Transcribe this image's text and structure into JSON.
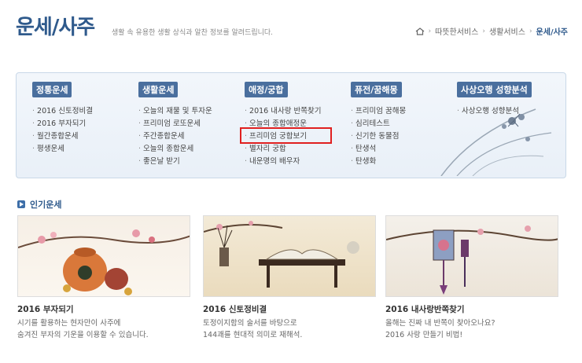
{
  "header": {
    "title": "운세/사주",
    "description": "생활 속 유용한 생활 상식과 알찬 정보를 알려드립니다.",
    "breadcrumb": [
      "따뜻한서비스",
      "생활서비스",
      "운세/사주"
    ]
  },
  "menu": {
    "columns": [
      {
        "head": "정통운세",
        "items": [
          "2016 신토정비결",
          "2016 부자되기",
          "월간종합운세",
          "평생운세"
        ]
      },
      {
        "head": "생활운세",
        "items": [
          "오늘의 재물 및 투자운",
          "프리미엄 로또운세",
          "주간종합운세",
          "오늘의 종합운세",
          "좋은날 받기"
        ]
      },
      {
        "head": "애정/궁합",
        "items": [
          "2016 내사랑 반쪽찾기",
          "오늘의 종합애정운",
          "프리미엄 궁합보기",
          "별자리 궁합",
          "내운명의 배우자"
        ]
      },
      {
        "head": "퓨전/꿈해몽",
        "items": [
          "프리미엄 꿈해몽",
          "심리테스트",
          "신기한 동물점",
          "탄생석",
          "탄생화"
        ]
      },
      {
        "head": "사상오행 성향분석",
        "items": [
          "사상오행 성향분석"
        ]
      }
    ]
  },
  "popular": {
    "title": "인기운세",
    "cards": [
      {
        "title": "2016 부자되기",
        "lines": [
          "시기를 활용하는 현자만이 사주에",
          "숨겨진 부자의 기운을 이용할 수 있습니다."
        ]
      },
      {
        "title": "2016 신토정비결",
        "lines": [
          "토정이지함의 술서를 바탕으로",
          "144괘를 현대적 의미로 재해석."
        ]
      },
      {
        "title": "2016 내사랑반쪽찾기",
        "lines": [
          "올해는 진짜 내 반쪽이 찾아오나요?",
          "2016 사랑 만들기 비법!"
        ]
      }
    ]
  },
  "colors": {
    "brand": "#2f5a8c",
    "head_bg": "#4a6f9e",
    "highlight": "#e02020"
  },
  "icons": [
    "home-icon",
    "section-bullet-icon"
  ]
}
